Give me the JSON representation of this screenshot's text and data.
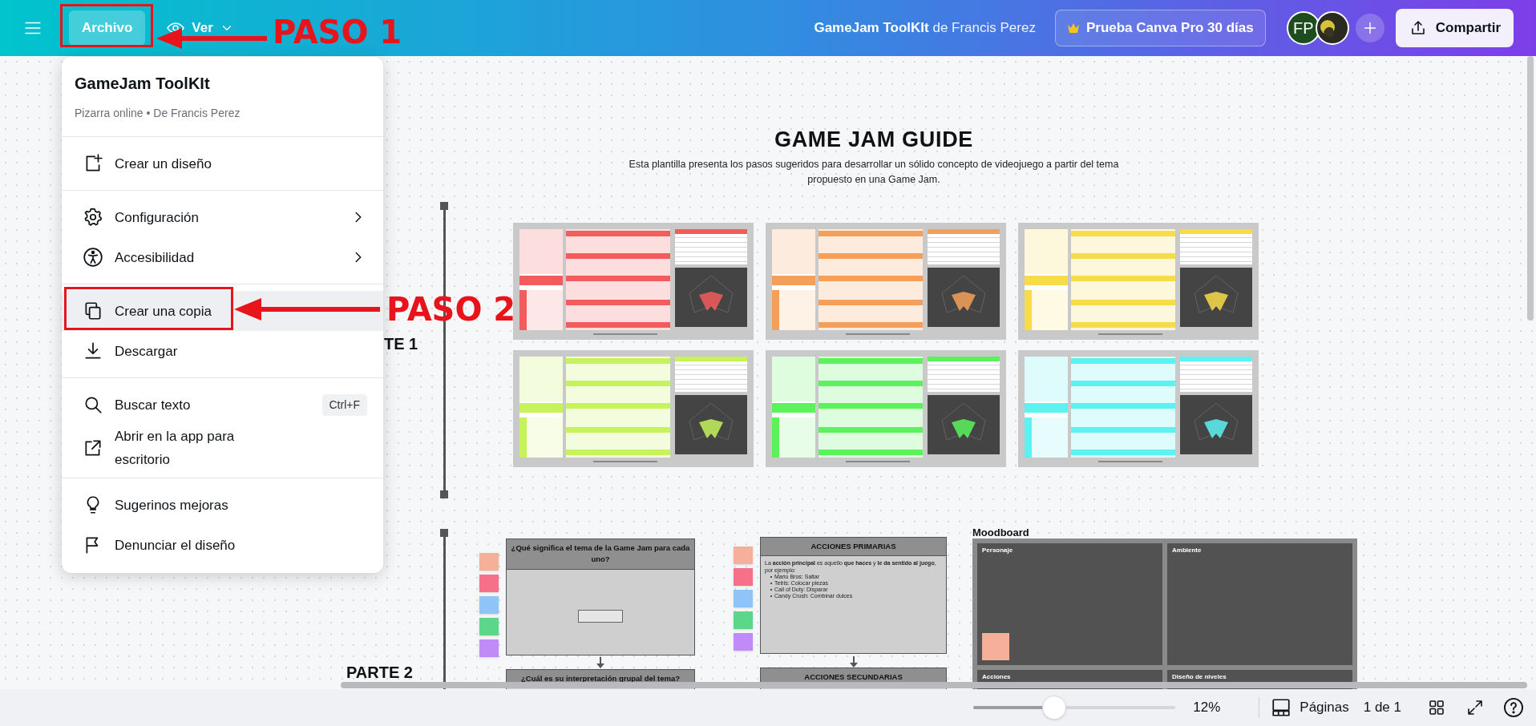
{
  "top_bar": {
    "file_button": {
      "label": "Archivo",
      "selected": true
    },
    "view_button": {
      "label": "Ver"
    },
    "title": "GameJam ToolKIt",
    "title_author": "de Francis Perez",
    "pro_button": "Prueba Canva Pro 30 días",
    "avatar_initials": "FP",
    "share_button": "Compartir"
  },
  "annotations": [
    {
      "label": "PASO 1"
    },
    {
      "label": "PASO 2"
    }
  ],
  "file_menu": {
    "title": "GameJam ToolKIt",
    "subtitle": "Pizarra online • De Francis Perez",
    "sections": [
      [
        {
          "label": "Crear un diseño",
          "submenu": false,
          "highlighted": false
        }
      ],
      [
        {
          "label": "Configuración",
          "submenu": true,
          "highlighted": false
        },
        {
          "label": "Accesibilidad",
          "submenu": true,
          "highlighted": false
        }
      ],
      [
        {
          "label": "Crear una copia",
          "submenu": false,
          "highlighted": true
        },
        {
          "label": "Descargar",
          "submenu": false,
          "highlighted": false
        }
      ],
      [
        {
          "label": "Buscar texto",
          "submenu": false,
          "highlighted": false,
          "shortcut": "Ctrl+F"
        },
        {
          "label": "Abrir en la app para escritorio",
          "submenu": false,
          "highlighted": false
        }
      ],
      [
        {
          "label": "Sugerinos mejoras",
          "submenu": false,
          "highlighted": false
        },
        {
          "label": "Denunciar el diseño",
          "submenu": false,
          "highlighted": false
        }
      ]
    ]
  },
  "canvas": {
    "guide": {
      "title": "GAME JAM GUIDE",
      "description": "Esta plantilla presenta los pasos sugeridos para desarrollar un sólido concepto de videojuego a partir del tema propuesto en una Game Jam."
    },
    "parts": [
      "TE 1",
      "PARTE 2"
    ],
    "cards": [
      {
        "color": "#f25c5c"
      },
      {
        "color": "#f5a05a"
      },
      {
        "color": "#f7dc4a"
      },
      {
        "color": "#c6f25a"
      },
      {
        "color": "#5cf25c"
      },
      {
        "color": "#5cf2f2"
      }
    ],
    "questions": {
      "notes": [
        {
          "color": "#f6b09a"
        },
        {
          "color": "#f7708a"
        },
        {
          "color": "#8ec4f7"
        },
        {
          "color": "#5cd68a"
        },
        {
          "color": "#c08af7"
        }
      ],
      "boxes": [
        "¿Qué significa el tema de la Game Jam para cada uno?",
        "¿Cuál es su interpretación grupal del tema?"
      ]
    },
    "actions": {
      "notes": [
        {
          "color": "#f6b09a"
        },
        {
          "color": "#f7708a"
        },
        {
          "color": "#8ec4f7"
        },
        {
          "color": "#5cd68a"
        },
        {
          "color": "#c08af7"
        }
      ],
      "primary_title": "ACCIONES PRIMARIAS",
      "intro": "La **acción principal** es aquello **que haces** y **le da sentido al juego**, por ejemplo:",
      "examples": [
        "Mario Bros: Saltar",
        "Tetris: Colocar piezas",
        "Call of Duty: Disparar",
        "Candy Crush: Combinar dulces"
      ],
      "secondary_title": "ACCIONES SECUNDARIAS"
    },
    "moodboard": {
      "title": "Moodboard",
      "cells": [
        "Personaje",
        "Ambiente",
        "Acciones",
        "Diseño de niveles"
      ]
    }
  },
  "bottom_bar": {
    "zoom": {
      "level": 0.4,
      "reading": "12%"
    },
    "pages_button": "Páginas",
    "page_count": "1 de 1"
  }
}
